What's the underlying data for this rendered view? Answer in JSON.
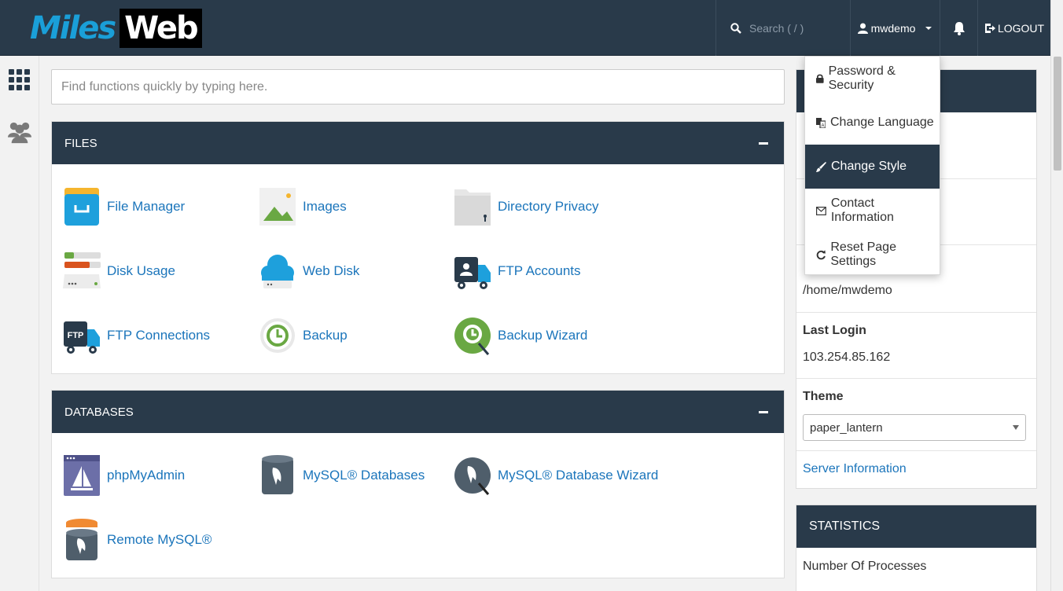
{
  "brand": {
    "logo_part1": "Miles",
    "logo_part2": "Web"
  },
  "topbar": {
    "search_placeholder": "Search ( / )",
    "username": "mwdemo",
    "logout_label": "LOGOUT"
  },
  "quickfind": {
    "placeholder": "Find functions quickly by typing here."
  },
  "files": {
    "title": "FILES",
    "items": [
      {
        "label": "File Manager"
      },
      {
        "label": "Images"
      },
      {
        "label": "Directory Privacy"
      },
      {
        "label": "Disk Usage"
      },
      {
        "label": "Web Disk"
      },
      {
        "label": "FTP Accounts"
      },
      {
        "label": "FTP Connections"
      },
      {
        "label": "Backup"
      },
      {
        "label": "Backup Wizard"
      }
    ]
  },
  "databases": {
    "title": "DATABASES",
    "items": [
      {
        "label": "phpMyAdmin"
      },
      {
        "label": "MySQL® Databases"
      },
      {
        "label": "MySQL® Database Wizard"
      },
      {
        "label": "Remote MySQL®"
      }
    ]
  },
  "user_menu": {
    "items": [
      {
        "label": "Password & Security",
        "icon": "lock-icon"
      },
      {
        "label": "Change Language",
        "icon": "language-icon"
      },
      {
        "label": "Change Style",
        "icon": "brush-icon",
        "active": true
      },
      {
        "label": "Contact Information",
        "icon": "envelope-icon"
      },
      {
        "label": "Reset Page Settings",
        "icon": "refresh-icon"
      }
    ]
  },
  "general_info": {
    "home_directory_value": "/home/mwdemo",
    "last_login_label": "Last Login",
    "last_login_value": "103.254.85.162",
    "theme_label": "Theme",
    "theme_value": "paper_lantern",
    "server_info_link": "Server Information"
  },
  "statistics": {
    "title": "STATISTICS",
    "first_row_label": "Number Of Processes"
  },
  "colors": {
    "header_bg": "#293a4a",
    "link": "#1b75bb",
    "brand_blue": "#1a9fd8"
  }
}
